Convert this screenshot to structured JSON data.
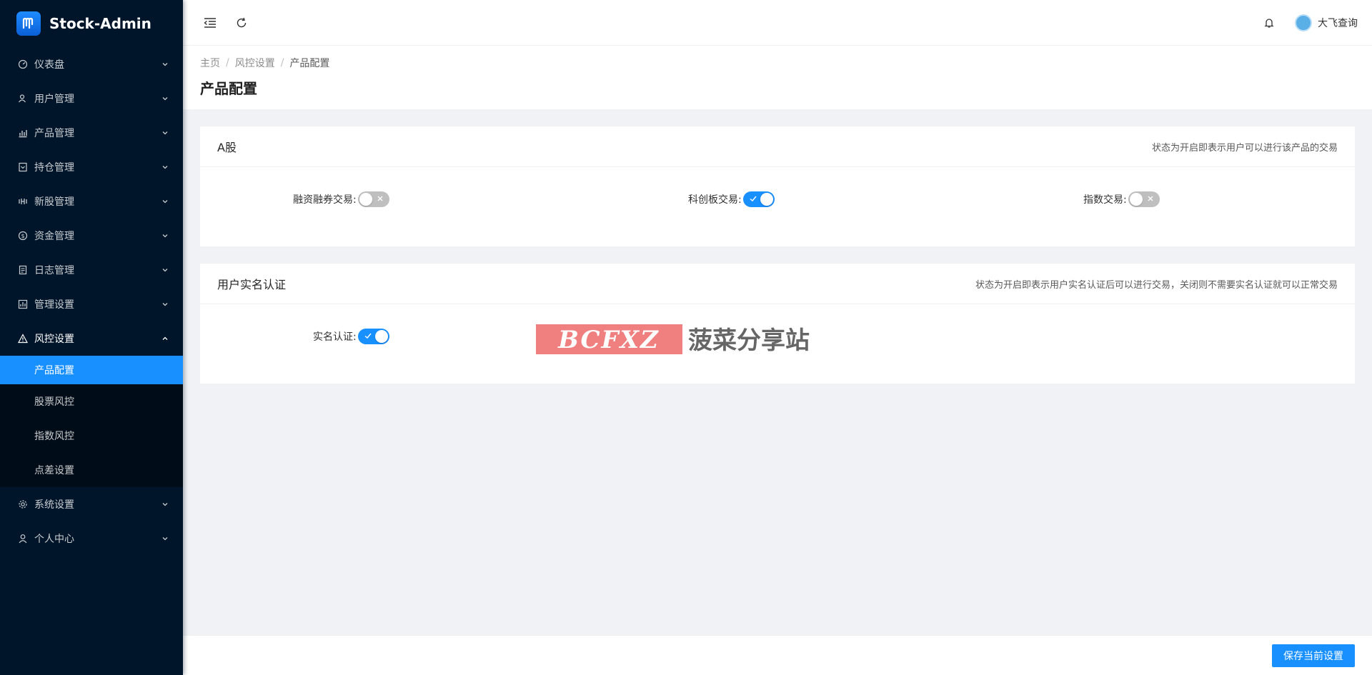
{
  "app": {
    "title": "Stock-Admin"
  },
  "sidebar": {
    "items": [
      {
        "label": "仪表盘",
        "icon": "dashboard-icon"
      },
      {
        "label": "用户管理",
        "icon": "user-manage-icon"
      },
      {
        "label": "产品管理",
        "icon": "chart-icon"
      },
      {
        "label": "持仓管理",
        "icon": "position-icon"
      },
      {
        "label": "新股管理",
        "icon": "new-stock-icon"
      },
      {
        "label": "资金管理",
        "icon": "money-icon"
      },
      {
        "label": "日志管理",
        "icon": "log-icon"
      },
      {
        "label": "管理设置",
        "icon": "manage-setting-icon"
      },
      {
        "label": "风控设置",
        "icon": "warning-icon"
      },
      {
        "label": "系统设置",
        "icon": "gear-icon"
      },
      {
        "label": "个人中心",
        "icon": "person-icon"
      }
    ],
    "risk_sub": [
      {
        "label": "产品配置",
        "active": true
      },
      {
        "label": "股票风控",
        "active": false
      },
      {
        "label": "指数风控",
        "active": false
      },
      {
        "label": "点差设置",
        "active": false
      }
    ]
  },
  "header": {
    "username": "大飞查询"
  },
  "breadcrumb": {
    "home": "主页",
    "parent": "风控设置",
    "current": "产品配置"
  },
  "page": {
    "title": "产品配置"
  },
  "cards": {
    "a_share": {
      "title": "A股",
      "hint": "状态为开启即表示用户可以进行该产品的交易",
      "margin_label": "融资融券交易:",
      "margin_on": false,
      "star_label": "科创板交易:",
      "star_on": true,
      "index_label": "指数交易:",
      "index_on": false
    },
    "realname": {
      "title": "用户实名认证",
      "hint": "状态为开启即表示用户实名认证后可以进行交易，关闭则不需要实名认证就可以正常交易",
      "label": "实名认证:",
      "on": true
    }
  },
  "watermark": {
    "latin": "BCFXZ",
    "cn": "菠菜分享站"
  },
  "footer": {
    "save_label": "保存当前设置"
  },
  "colors": {
    "primary": "#1890ff",
    "sidebar": "#001529",
    "watermark": "#f08080"
  }
}
